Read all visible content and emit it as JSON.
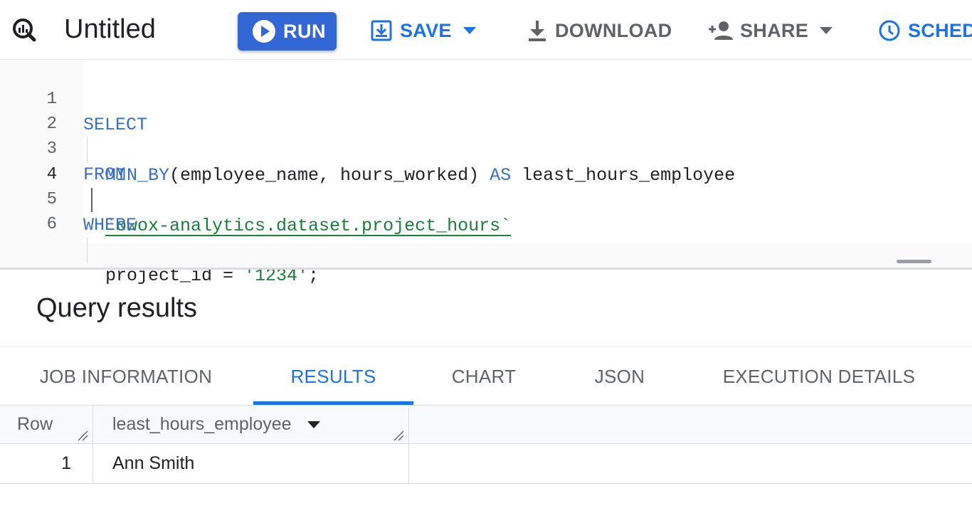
{
  "toolbar": {
    "title": "Untitled",
    "run_label": "RUN",
    "save_label": "SAVE",
    "download_label": "DOWNLOAD",
    "share_label": "SHARE",
    "schedule_label": "SCHED"
  },
  "editor": {
    "line_numbers": [
      "1",
      "2",
      "3",
      "4",
      "5",
      "6"
    ],
    "lines": {
      "l1_kw": "SELECT",
      "l2_fn": "MIN_BY",
      "l2_args": "(employee_name, hours_worked) ",
      "l2_as": "AS",
      "l2_alias": " least_hours_employee",
      "l3_kw": "FROM",
      "l4_table": "`owox-analytics.dataset.project_hours`",
      "l5_kw": "WHERE",
      "l6_col": "project_id = ",
      "l6_val": "'1234'",
      "l6_end": ";"
    },
    "active_line": 4
  },
  "results": {
    "title": "Query results",
    "tabs": [
      "JOB INFORMATION",
      "RESULTS",
      "CHART",
      "JSON",
      "EXECUTION DETAILS"
    ],
    "active_tab": "RESULTS",
    "columns": [
      "Row",
      "least_hours_employee"
    ],
    "rows": [
      {
        "row": "1",
        "least_hours_employee": "Ann Smith"
      }
    ]
  },
  "colors": {
    "accent": "#1a73e8",
    "run_button": "#3367d6",
    "keyword": "#3b6fc2",
    "string": "#188038"
  },
  "icons": {
    "logo": "bigquery-logo-icon",
    "run": "play-circle-icon",
    "save": "save-icon",
    "download": "download-icon",
    "share": "person-add-icon",
    "schedule": "clock-icon"
  }
}
